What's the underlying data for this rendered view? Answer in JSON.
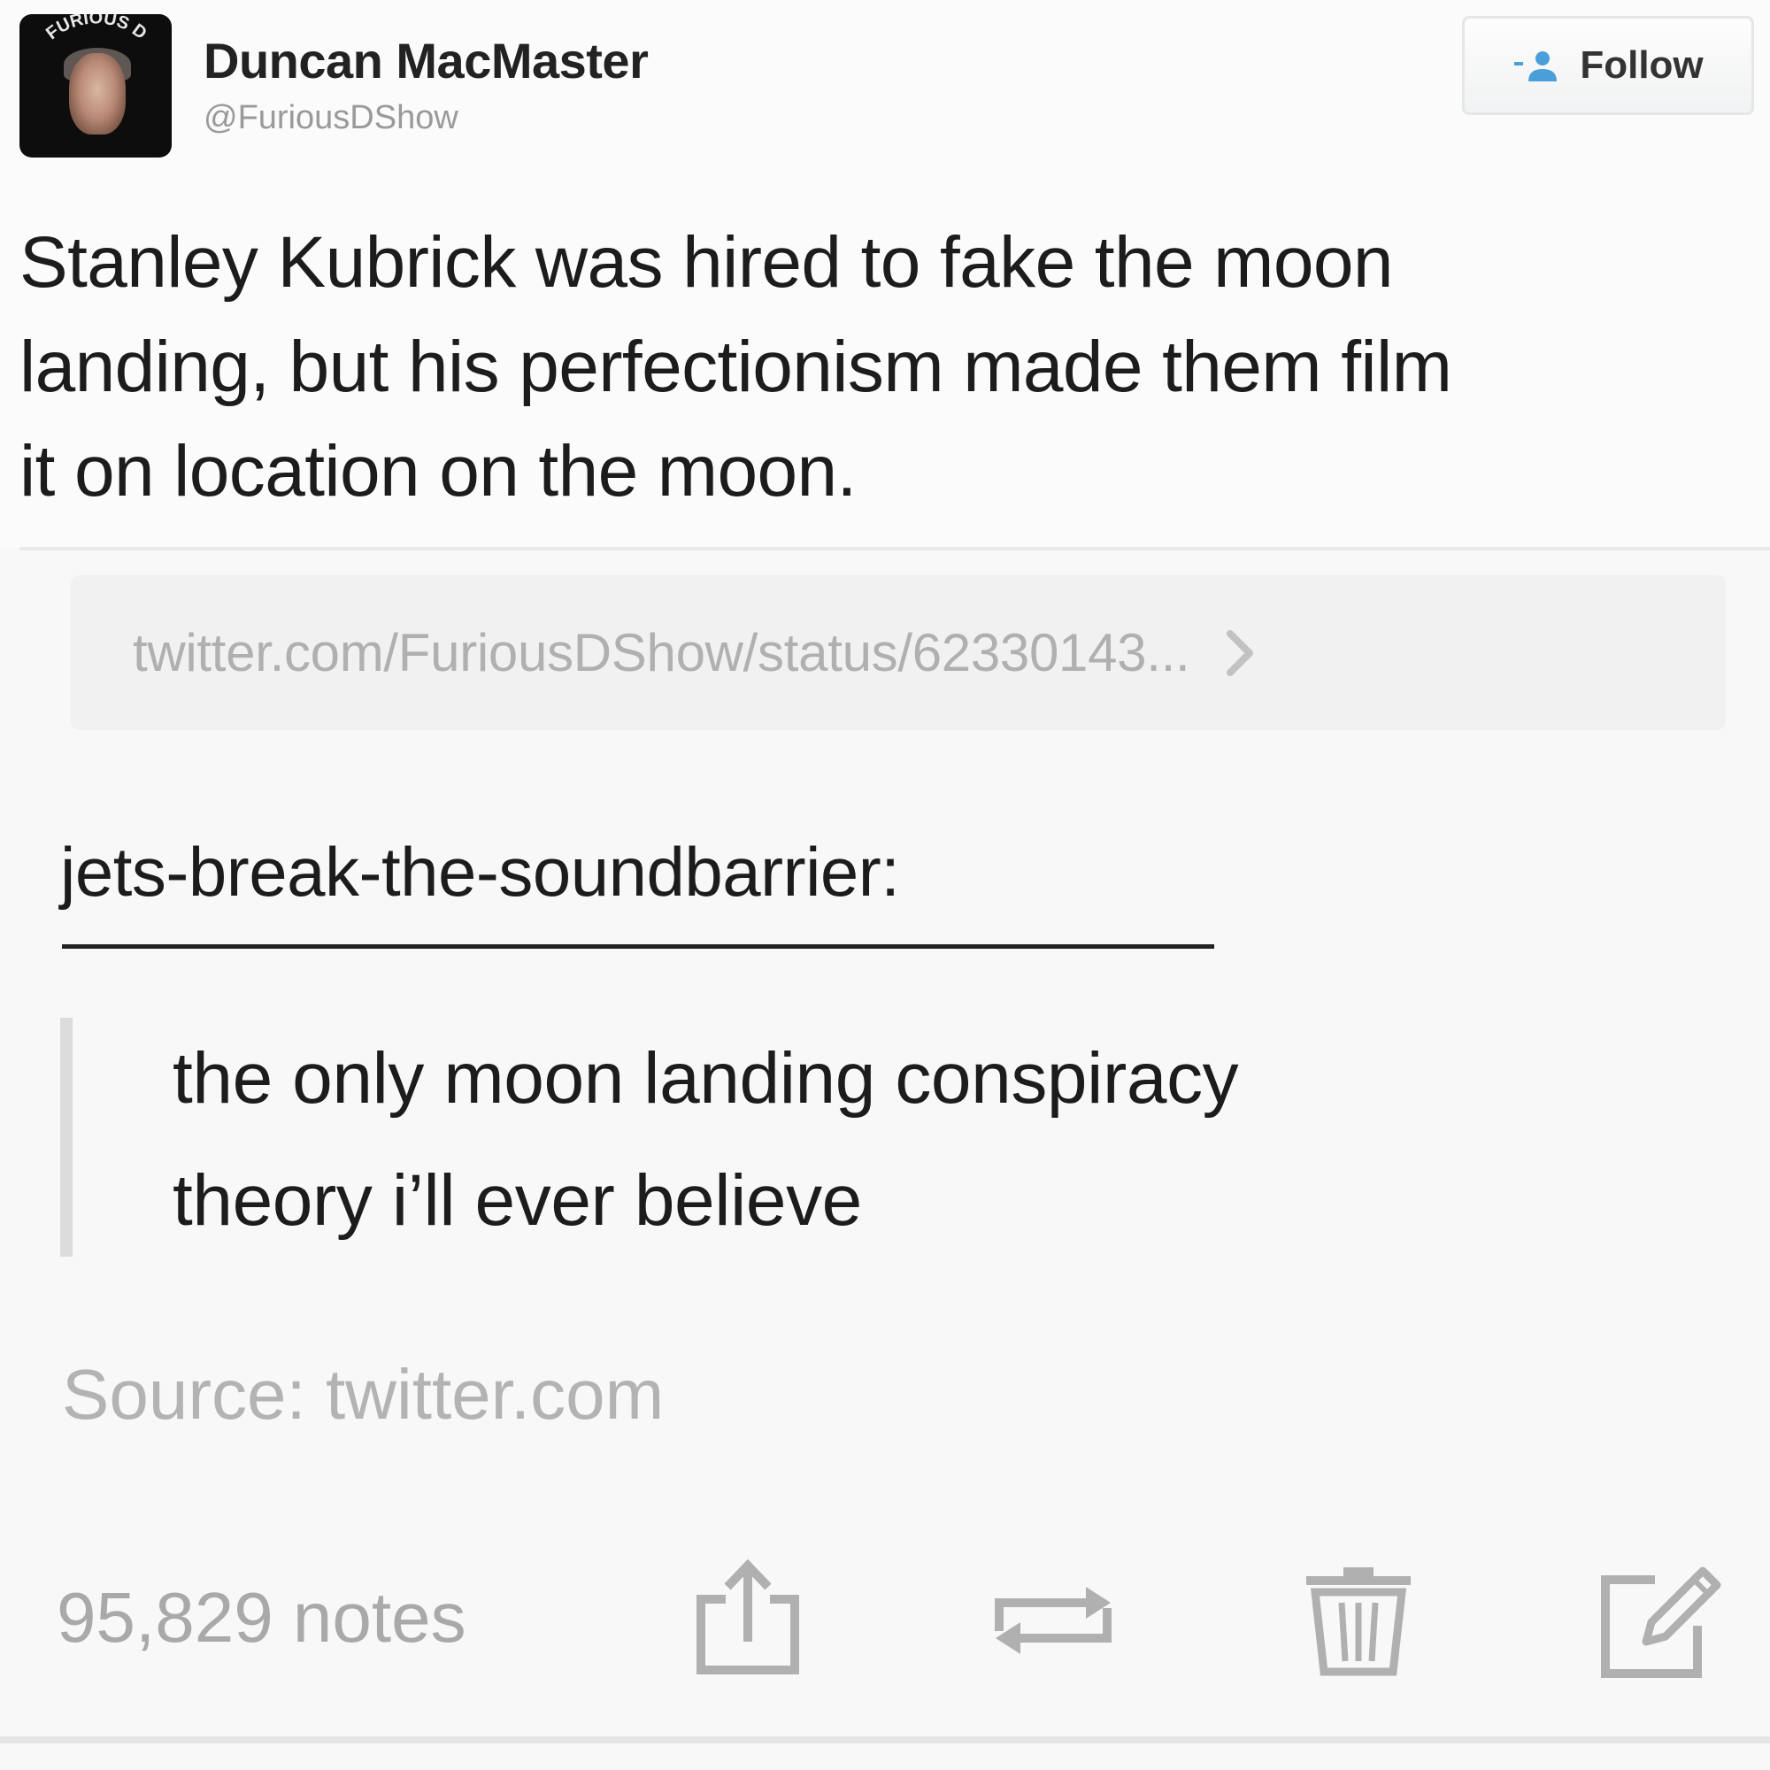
{
  "tweet": {
    "author_name": "Duncan MacMaster",
    "author_handle": "@FuriousDShow",
    "avatar_label": "FURIOUS D",
    "follow_label": "Follow",
    "text_lines": [
      "Stanley Kubrick was hired to fake the moon",
      "landing, but his perfectionism made them film",
      "it on location on the moon."
    ]
  },
  "link": {
    "url_text": "twitter.com/FuriousDShow/status/62330143..."
  },
  "reblog": {
    "blog_name": "jets-break-the-soundbarrier:",
    "quote_lines": [
      "the only moon landing conspiracy",
      "theory i’ll ever believe"
    ]
  },
  "source": {
    "label": "Source:",
    "link": "twitter.com"
  },
  "footer": {
    "notes": "95,829 notes",
    "actions": [
      "share-icon",
      "reblog-icon",
      "delete-icon",
      "edit-icon"
    ]
  },
  "colors": {
    "text": "#1c1c1c",
    "muted": "#a9a9a9",
    "link_bar_bg": "#f1f1f1",
    "quote_bar": "#dcdcdc"
  }
}
